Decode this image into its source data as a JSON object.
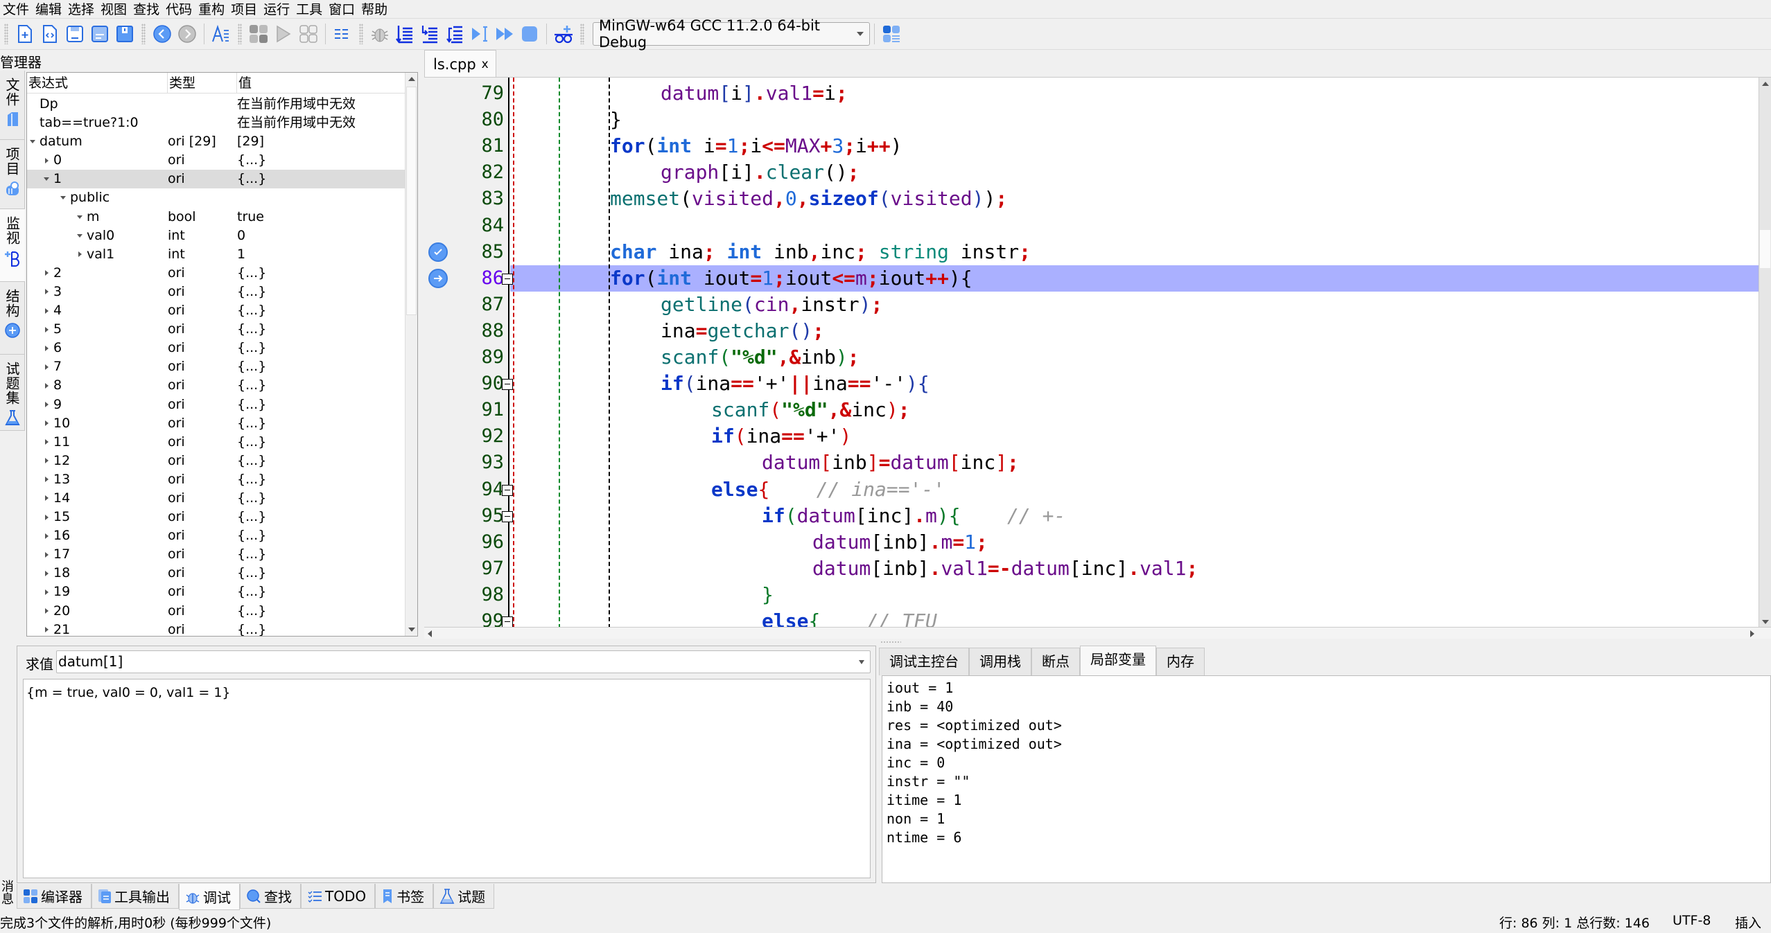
{
  "menu": [
    "文件",
    "编辑",
    "选择",
    "视图",
    "查找",
    "代码",
    "重构",
    "项目",
    "运行",
    "工具",
    "窗口",
    "帮助"
  ],
  "toolbar": {
    "buttons": [
      "new-file",
      "new-source",
      "save",
      "save-as",
      "save-all",
      "back",
      "forward",
      "format",
      "compile",
      "run",
      "compile-run",
      "options",
      "debug",
      "step-into",
      "step-over",
      "step-out",
      "continue",
      "run-to",
      "stop",
      "add-watch",
      "compiler-options"
    ],
    "compiler": "MinGW-w64 GCC 11.2.0 64-bit Debug"
  },
  "left_panel": {
    "title": "管理器",
    "vertical_tabs": [
      "文件",
      "项目",
      "监视",
      "结构",
      "试题集"
    ],
    "active_tab": "监视",
    "watch": {
      "columns": [
        "表达式",
        "类型",
        "值"
      ],
      "rows": [
        {
          "expr": "Dp",
          "type": "",
          "value": "在当前作用域中无效",
          "depth": 0,
          "twisty": "none"
        },
        {
          "expr": "tab==true?1:0",
          "type": "",
          "value": "在当前作用域中无效",
          "depth": 0,
          "twisty": "none"
        },
        {
          "expr": "datum",
          "type": "ori [29]",
          "value": "[29]",
          "depth": 0,
          "twisty": "open"
        },
        {
          "expr": "0",
          "type": "ori",
          "value": "{...}",
          "depth": 1,
          "twisty": "closed"
        },
        {
          "expr": "1",
          "type": "ori",
          "value": "{...}",
          "depth": 1,
          "twisty": "open",
          "selected": true
        },
        {
          "expr": "public",
          "type": "",
          "value": "",
          "depth": 2,
          "twisty": "open"
        },
        {
          "expr": "m",
          "type": "bool",
          "value": "true",
          "depth": 3,
          "twisty": "open"
        },
        {
          "expr": "val0",
          "type": "int",
          "value": "0",
          "depth": 3,
          "twisty": "open"
        },
        {
          "expr": "val1",
          "type": "int",
          "value": "1",
          "depth": 3,
          "twisty": "closed"
        },
        {
          "expr": "2",
          "type": "ori",
          "value": "{...}",
          "depth": 1,
          "twisty": "closed"
        },
        {
          "expr": "3",
          "type": "ori",
          "value": "{...}",
          "depth": 1,
          "twisty": "closed"
        },
        {
          "expr": "4",
          "type": "ori",
          "value": "{...}",
          "depth": 1,
          "twisty": "closed"
        },
        {
          "expr": "5",
          "type": "ori",
          "value": "{...}",
          "depth": 1,
          "twisty": "closed"
        },
        {
          "expr": "6",
          "type": "ori",
          "value": "{...}",
          "depth": 1,
          "twisty": "closed"
        },
        {
          "expr": "7",
          "type": "ori",
          "value": "{...}",
          "depth": 1,
          "twisty": "closed"
        },
        {
          "expr": "8",
          "type": "ori",
          "value": "{...}",
          "depth": 1,
          "twisty": "closed"
        },
        {
          "expr": "9",
          "type": "ori",
          "value": "{...}",
          "depth": 1,
          "twisty": "closed"
        },
        {
          "expr": "10",
          "type": "ori",
          "value": "{...}",
          "depth": 1,
          "twisty": "closed"
        },
        {
          "expr": "11",
          "type": "ori",
          "value": "{...}",
          "depth": 1,
          "twisty": "closed"
        },
        {
          "expr": "12",
          "type": "ori",
          "value": "{...}",
          "depth": 1,
          "twisty": "closed"
        },
        {
          "expr": "13",
          "type": "ori",
          "value": "{...}",
          "depth": 1,
          "twisty": "closed"
        },
        {
          "expr": "14",
          "type": "ori",
          "value": "{...}",
          "depth": 1,
          "twisty": "closed"
        },
        {
          "expr": "15",
          "type": "ori",
          "value": "{...}",
          "depth": 1,
          "twisty": "closed"
        },
        {
          "expr": "16",
          "type": "ori",
          "value": "{...}",
          "depth": 1,
          "twisty": "closed"
        },
        {
          "expr": "17",
          "type": "ori",
          "value": "{...}",
          "depth": 1,
          "twisty": "closed"
        },
        {
          "expr": "18",
          "type": "ori",
          "value": "{...}",
          "depth": 1,
          "twisty": "closed"
        },
        {
          "expr": "19",
          "type": "ori",
          "value": "{...}",
          "depth": 1,
          "twisty": "closed"
        },
        {
          "expr": "20",
          "type": "ori",
          "value": "{...}",
          "depth": 1,
          "twisty": "closed"
        },
        {
          "expr": "21",
          "type": "ori",
          "value": "{...}",
          "depth": 1,
          "twisty": "closed"
        }
      ]
    }
  },
  "editor": {
    "tab": {
      "label": "ls.cpp",
      "close": "x"
    },
    "current_line": 86,
    "lines": [
      {
        "n": 79,
        "indent": 2,
        "tokens": [
          [
            "v",
            "datum"
          ],
          [
            "br1",
            "["
          ],
          [
            "",
            "i"
          ],
          [
            "br1",
            "]"
          ],
          [
            "p",
            "."
          ],
          [
            "v",
            "val1"
          ],
          [
            "p",
            "="
          ],
          [
            "",
            "i"
          ],
          [
            "p",
            ";"
          ]
        ]
      },
      {
        "n": 80,
        "indent": 1,
        "tokens": [
          [
            "",
            "}"
          ]
        ]
      },
      {
        "n": 81,
        "indent": 1,
        "tokens": [
          [
            "k",
            "for"
          ],
          [
            "",
            "("
          ],
          [
            "t",
            "int"
          ],
          [
            "",
            " i"
          ],
          [
            "p",
            "="
          ],
          [
            "n",
            "1"
          ],
          [
            "p",
            ";"
          ],
          [
            "",
            "i"
          ],
          [
            "p",
            "<="
          ],
          [
            "v",
            "MAX"
          ],
          [
            "p",
            "+"
          ],
          [
            "n",
            "3"
          ],
          [
            "p",
            ";"
          ],
          [
            "",
            "i"
          ],
          [
            "p",
            "++"
          ],
          [
            "",
            ")"
          ]
        ]
      },
      {
        "n": 82,
        "indent": 2,
        "tokens": [
          [
            "v",
            "graph"
          ],
          [
            "",
            "["
          ],
          [
            "",
            "i"
          ],
          [
            "",
            "]"
          ],
          [
            "p",
            "."
          ],
          [
            "f",
            "clear"
          ],
          [
            "",
            "()"
          ],
          [
            "p",
            ";"
          ]
        ]
      },
      {
        "n": 83,
        "indent": 1,
        "tokens": [
          [
            "f",
            "memset"
          ],
          [
            "",
            "("
          ],
          [
            "v",
            "visited"
          ],
          [
            "p",
            ","
          ],
          [
            "n",
            "0"
          ],
          [
            "p",
            ","
          ],
          [
            "k",
            "sizeof"
          ],
          [
            "br1",
            "("
          ],
          [
            "v",
            "visited"
          ],
          [
            "br1",
            ")"
          ],
          [
            "",
            ")"
          ],
          [
            "p",
            ";"
          ]
        ]
      },
      {
        "n": 84,
        "indent": 0,
        "tokens": []
      },
      {
        "n": 85,
        "indent": 1,
        "breakpoint": "check",
        "tokens": [
          [
            "t",
            "char"
          ],
          [
            "",
            " ina"
          ],
          [
            "p",
            ";"
          ],
          [
            "",
            " "
          ],
          [
            "t",
            "int"
          ],
          [
            "",
            " inb"
          ],
          [
            "p",
            ","
          ],
          [
            "",
            "inc"
          ],
          [
            "p",
            ";"
          ],
          [
            "",
            " "
          ],
          [
            "s",
            "string"
          ],
          [
            "",
            " instr"
          ],
          [
            "p",
            ";"
          ]
        ]
      },
      {
        "n": 86,
        "indent": 1,
        "breakpoint": "current",
        "fold": true,
        "tokens": [
          [
            "k",
            "for"
          ],
          [
            "",
            "("
          ],
          [
            "t",
            "int"
          ],
          [
            "",
            " iout"
          ],
          [
            "p",
            "="
          ],
          [
            "n",
            "1"
          ],
          [
            "p",
            ";"
          ],
          [
            "",
            "iout"
          ],
          [
            "p",
            "<="
          ],
          [
            "v",
            "m"
          ],
          [
            "p",
            ";"
          ],
          [
            "",
            "iout"
          ],
          [
            "p",
            "++"
          ],
          [
            "",
            ")"
          ],
          [
            "",
            "{"
          ]
        ]
      },
      {
        "n": 87,
        "indent": 2,
        "tokens": [
          [
            "f",
            "getline"
          ],
          [
            "br1",
            "("
          ],
          [
            "v",
            "cin"
          ],
          [
            "p",
            ","
          ],
          [
            "",
            "instr"
          ],
          [
            "br1",
            ")"
          ],
          [
            "p",
            ";"
          ]
        ]
      },
      {
        "n": 88,
        "indent": 2,
        "tokens": [
          [
            "",
            "ina"
          ],
          [
            "p",
            "="
          ],
          [
            "f",
            "getchar"
          ],
          [
            "br1",
            "()"
          ],
          [
            "p",
            ";"
          ]
        ]
      },
      {
        "n": 89,
        "indent": 2,
        "tokens": [
          [
            "f",
            "scanf"
          ],
          [
            "br3",
            "("
          ],
          [
            "str",
            "\"%d\""
          ],
          [
            "p",
            ","
          ],
          [
            "p",
            "&"
          ],
          [
            "",
            "inb"
          ],
          [
            "br3",
            ")"
          ],
          [
            "p",
            ";"
          ]
        ]
      },
      {
        "n": 90,
        "indent": 2,
        "fold": true,
        "tokens": [
          [
            "k",
            "if"
          ],
          [
            "br1",
            "("
          ],
          [
            "",
            "ina"
          ],
          [
            "p",
            "=="
          ],
          [
            "",
            "'+'"
          ],
          [
            "p",
            "||"
          ],
          [
            "",
            "ina"
          ],
          [
            "p",
            "=="
          ],
          [
            "",
            "'-'"
          ],
          [
            "br1",
            ")"
          ],
          [
            "br1",
            "{"
          ]
        ]
      },
      {
        "n": 91,
        "indent": 3,
        "tokens": [
          [
            "f",
            "scanf"
          ],
          [
            "br2",
            "("
          ],
          [
            "str",
            "\"%d\""
          ],
          [
            "p",
            ","
          ],
          [
            "p",
            "&"
          ],
          [
            "",
            "inc"
          ],
          [
            "br2",
            ")"
          ],
          [
            "p",
            ";"
          ]
        ]
      },
      {
        "n": 92,
        "indent": 3,
        "tokens": [
          [
            "k",
            "if"
          ],
          [
            "br2",
            "("
          ],
          [
            "",
            "ina"
          ],
          [
            "p",
            "=="
          ],
          [
            "",
            "'+'"
          ],
          [
            "br2",
            ")"
          ]
        ]
      },
      {
        "n": 93,
        "indent": 4,
        "tokens": [
          [
            "v",
            "datum"
          ],
          [
            "br2",
            "["
          ],
          [
            "",
            "inb"
          ],
          [
            "br2",
            "]"
          ],
          [
            "p",
            "="
          ],
          [
            "v",
            "datum"
          ],
          [
            "br2",
            "["
          ],
          [
            "",
            "inc"
          ],
          [
            "br2",
            "]"
          ],
          [
            "p",
            ";"
          ]
        ]
      },
      {
        "n": 94,
        "indent": 3,
        "fold": true,
        "tokens": [
          [
            "k",
            "else"
          ],
          [
            "br2",
            "{"
          ],
          [
            "",
            "    "
          ],
          [
            "cm",
            "// ina=='-'"
          ]
        ]
      },
      {
        "n": 95,
        "indent": 4,
        "fold": true,
        "tokens": [
          [
            "k",
            "if"
          ],
          [
            "br3",
            "("
          ],
          [
            "v",
            "datum"
          ],
          [
            "",
            "["
          ],
          [
            "",
            "inc"
          ],
          [
            "",
            "]"
          ],
          [
            "p",
            "."
          ],
          [
            "v",
            "m"
          ],
          [
            "br3",
            ")"
          ],
          [
            "br3",
            "{"
          ],
          [
            "",
            "    "
          ],
          [
            "cm",
            "// +-"
          ]
        ]
      },
      {
        "n": 96,
        "indent": 5,
        "tokens": [
          [
            "v",
            "datum"
          ],
          [
            "",
            "["
          ],
          [
            "",
            "inb"
          ],
          [
            "",
            "]"
          ],
          [
            "p",
            "."
          ],
          [
            "v",
            "m"
          ],
          [
            "p",
            "="
          ],
          [
            "n",
            "1"
          ],
          [
            "p",
            ";"
          ]
        ]
      },
      {
        "n": 97,
        "indent": 5,
        "tokens": [
          [
            "v",
            "datum"
          ],
          [
            "",
            "["
          ],
          [
            "",
            "inb"
          ],
          [
            "",
            "]"
          ],
          [
            "p",
            "."
          ],
          [
            "v",
            "val1"
          ],
          [
            "p",
            "=-"
          ],
          [
            "v",
            "datum"
          ],
          [
            "",
            "["
          ],
          [
            "",
            "inc"
          ],
          [
            "",
            "]"
          ],
          [
            "p",
            "."
          ],
          [
            "v",
            "val1"
          ],
          [
            "p",
            ";"
          ]
        ]
      },
      {
        "n": 98,
        "indent": 4,
        "tokens": [
          [
            "br3",
            "}"
          ]
        ]
      },
      {
        "n": 99,
        "indent": 4,
        "fold": true,
        "tokens": [
          [
            "k",
            "else"
          ],
          [
            "br3",
            "{"
          ],
          [
            "",
            "    "
          ],
          [
            "cm",
            "// TFU"
          ]
        ]
      }
    ]
  },
  "evaluate": {
    "label": "求值",
    "expression": "datum[1]",
    "result": "{m = true, val0 = 0, val1 = 1}"
  },
  "debug_panel": {
    "tabs": [
      "调试主控台",
      "调用栈",
      "断点",
      "局部变量",
      "内存"
    ],
    "active_tab": "局部变量",
    "locals": [
      "iout = 1",
      "inb = 40",
      "res = <optimized out>",
      "ina = <optimized out>",
      "inc = 0",
      "instr = \"\"",
      "itime = 1",
      "non = 1",
      "ntime = 6"
    ]
  },
  "bottom_vertical_label": "消息",
  "bottom_tabs": [
    {
      "label": "编译器",
      "icon": "compiler-icon"
    },
    {
      "label": "工具输出",
      "icon": "tool-output-icon"
    },
    {
      "label": "调试",
      "icon": "debug-icon",
      "active": true
    },
    {
      "label": "查找",
      "icon": "search-icon"
    },
    {
      "label": "TODO",
      "icon": "todo-icon"
    },
    {
      "label": "书签",
      "icon": "bookmark-icon"
    },
    {
      "label": "试题",
      "icon": "problem-icon"
    }
  ],
  "status": {
    "message": "完成3个文件的解析,用时0秒 (每秒999个文件)",
    "position": "行: 86 列: 1 总行数: 146",
    "encoding": "UTF-8",
    "mode": "插入"
  },
  "colors": {
    "accent": "#3a7de0",
    "current_line": "#aab0ff",
    "selected_row": "#dcdcdc"
  }
}
